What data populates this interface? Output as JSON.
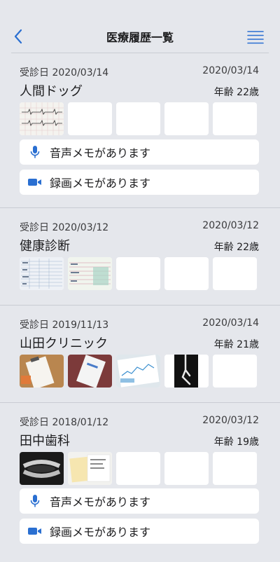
{
  "header": {
    "title": "医療履歴一覧",
    "back_icon": "chevron-left-icon",
    "menu_icon": "hamburger-menu-icon",
    "accent_color": "#2a6fd1"
  },
  "records": [
    {
      "visit_label": "受診日 2020/03/14",
      "record_date": "2020/03/14",
      "name": "人間ドッグ",
      "age": "年齢 22歳",
      "memos": [
        {
          "label": "音声メモがあります",
          "icon": "microphone-icon"
        },
        {
          "label": "録画メモがあります",
          "icon": "video-camera-icon"
        }
      ]
    },
    {
      "visit_label": "受診日 2020/03/12",
      "record_date": "2020/03/12",
      "name": "健康診断",
      "age": "年齢 22歳",
      "memos": []
    },
    {
      "visit_label": "受診日 2019/11/13",
      "record_date": "2020/03/14",
      "name": "山田クリニック",
      "age": "年齢 21歳",
      "memos": []
    },
    {
      "visit_label": "受診日 2018/01/12",
      "record_date": "2020/03/12",
      "name": "田中歯科",
      "age": "年齢 19歳",
      "memos": [
        {
          "label": "音声メモがあります",
          "icon": "microphone-icon"
        },
        {
          "label": "録画メモがあります",
          "icon": "video-camera-icon"
        }
      ]
    }
  ]
}
